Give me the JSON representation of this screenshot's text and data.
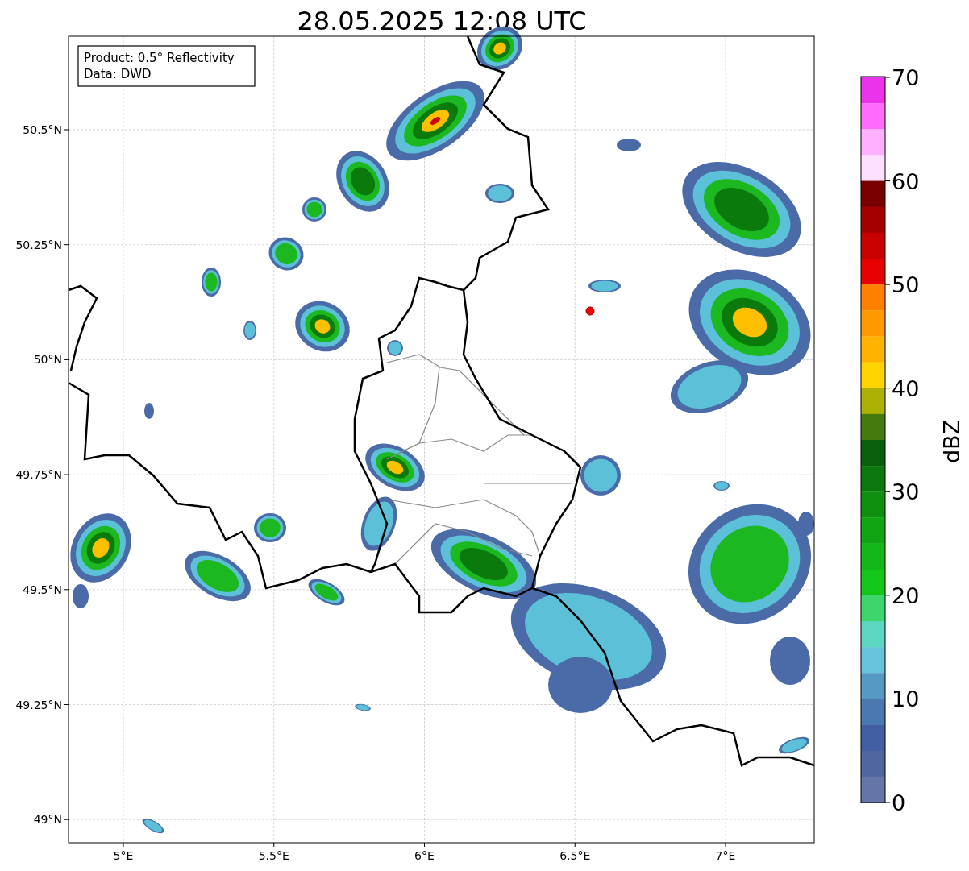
{
  "figure": {
    "title": "28.05.2025 12:08 UTC"
  },
  "map": {
    "info_box": [
      "Product: 0.5° Reflectivity",
      "Data: DWD"
    ],
    "y_tick_labels": [
      "50.5°N",
      "50.25°N",
      "50°N",
      "49.75°N",
      "49.5°N",
      "49.25°N",
      "49°N"
    ],
    "x_tick_labels": [
      "5°E",
      "5.5°E",
      "6°E",
      "6.5°E",
      "7°E"
    ]
  },
  "colorbar": {
    "label": "dBZ",
    "tick_labels": [
      "70",
      "60",
      "50",
      "40",
      "30",
      "20",
      "10",
      "0"
    ],
    "segments": [
      {
        "color": "#ec33ec"
      },
      {
        "color": "#ff6bff"
      },
      {
        "color": "#ffb0ff"
      },
      {
        "color": "#ffdfff"
      },
      {
        "color": "#7a0000"
      },
      {
        "color": "#a50000"
      },
      {
        "color": "#c80000"
      },
      {
        "color": "#e80000"
      },
      {
        "color": "#ff7f00"
      },
      {
        "color": "#ff9900"
      },
      {
        "color": "#ffb300"
      },
      {
        "color": "#ffd400"
      },
      {
        "color": "#adb103"
      },
      {
        "color": "#457a0e"
      },
      {
        "color": "#0a5f0c"
      },
      {
        "color": "#0c770d"
      },
      {
        "color": "#0f8f10"
      },
      {
        "color": "#12a512"
      },
      {
        "color": "#14b71a"
      },
      {
        "color": "#12c61a"
      },
      {
        "color": "#3ed66c"
      },
      {
        "color": "#5dd6c0"
      },
      {
        "color": "#66c3dc"
      },
      {
        "color": "#5599c4"
      },
      {
        "color": "#4a78b0"
      },
      {
        "color": "#425fa3"
      },
      {
        "color": "#5066a0"
      },
      {
        "color": "#6475a8"
      }
    ]
  }
}
